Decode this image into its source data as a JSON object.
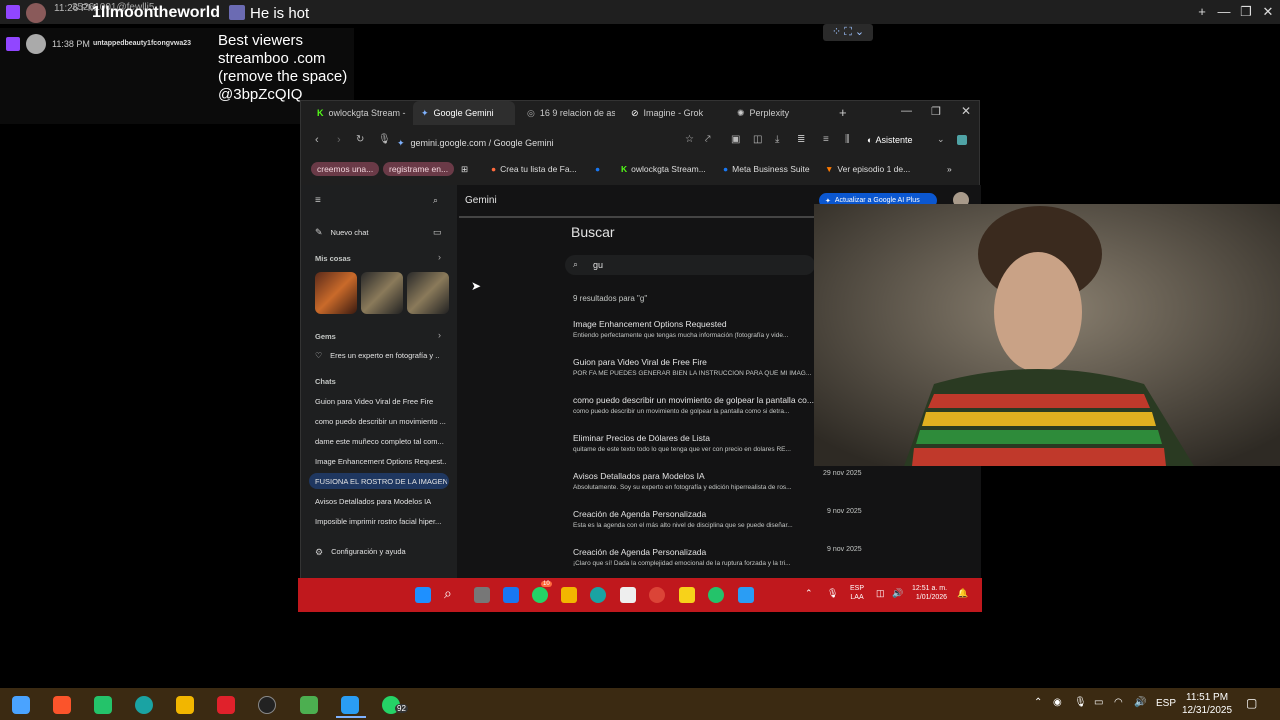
{
  "overlay": {
    "top_name": "1llmoontheworld",
    "top_message": "He is hot",
    "top_hidden": "35261001@fewlli5",
    "top_time": "11:26 PM",
    "chat_time": "11:38 PM",
    "chat_user": "untappedbeauty1fcongvwa23",
    "chat_message": "Best viewers streamboo .com (remove the space) @3bpZcQIQ"
  },
  "browser": {
    "tabs": [
      {
        "label": "owlockgta Stream -",
        "icon": "kick-icon"
      },
      {
        "label": "Google Gemini",
        "icon": "gemini-icon"
      },
      {
        "label": "16 9 relacion de asp",
        "icon": "globe-icon"
      },
      {
        "label": "Imagine - Grok",
        "icon": "grok-icon"
      },
      {
        "label": "Perplexity",
        "icon": "perplexity-icon"
      }
    ],
    "url": "gemini.google.com / Google Gemini",
    "assistant_label": "Asistente",
    "bookmarks": [
      "creemos una...",
      "registrame en...",
      "Crea tu lista de Fa...",
      "owlockgta Stream...",
      "Meta Business Suite",
      "Ver episodio 1 de..."
    ]
  },
  "gemini": {
    "app_name": "Gemini",
    "upgrade_label": "Actualizar a Google AI Plus",
    "new_chat": "Nuevo chat",
    "my_stuff": "Mis cosas",
    "gems": "Gems",
    "gem_item": "Eres un experto en fotografía y ...",
    "chats_header": "Chats",
    "chats": [
      "Guion para Video Viral de Free Fire",
      "como puedo describir un movimiento ...",
      "dame este muñeco completo tal com...",
      "Image Enhancement Options Request...",
      "FUSIONA EL ROSTRO DE LA IMAGEN ...",
      "Avisos Detallados para Modelos IA",
      "Imposible imprimir rostro facial hiper..."
    ],
    "settings": "Configuración y ayuda",
    "search_title": "Buscar",
    "search_value": "gu",
    "results_count": "9 resultados para \"g\"",
    "results": [
      {
        "title": "Image Enhancement Options Requested",
        "snippet": "Entiendo perfectamente que tengas mucha información (fotografía y vide...",
        "date": ""
      },
      {
        "title": "Guion para Video Viral de Free Fire",
        "snippet": "POR FA ME PUEDES GENERAR BIEN LA INSTRUCCION PARA QUE MI IMAG...",
        "date": ""
      },
      {
        "title": "como puedo describir un movimiento de golpear la pantalla co...",
        "snippet": "como puedo describir un movimiento de golpear la pantalla  como si detra...",
        "date": ""
      },
      {
        "title": "Eliminar Precios de Dólares de Lista",
        "snippet": "quitame de este texto todo lo que tenga que ver con precio en dolares RE...",
        "date": ""
      },
      {
        "title": "Avisos Detallados para Modelos IA",
        "snippet": "Absolutamente. Soy su experto en fotografía y edición hiperrealista de ros...",
        "date": "29 nov 2025"
      },
      {
        "title": "Creación de Agenda Personalizada",
        "snippet": "Esta es la agenda con el más alto nivel de disciplina que se puede diseñar...",
        "date": "9 nov 2025"
      },
      {
        "title": "Creación de Agenda Personalizada",
        "snippet": "¡Claro que sí! Dada la complejidad emocional de la ruptura forzada y la tri...",
        "date": "9 nov 2025"
      }
    ]
  },
  "inner_taskbar": {
    "lang_top": "ESP",
    "lang_bottom": "LAA",
    "time": "12:51 a. m.",
    "date": "1/01/2026",
    "badge": "10"
  },
  "taskbar": {
    "lang": "ESP",
    "time": "11:51 PM",
    "date": "12/31/2025",
    "whatsapp_badge": "92"
  },
  "colors": {
    "inner_taskbar": "#c0181d",
    "outer_taskbar": "#3b2a12",
    "highlight_chat": "#1f3760",
    "upgrade_button": "#0b57d0"
  }
}
